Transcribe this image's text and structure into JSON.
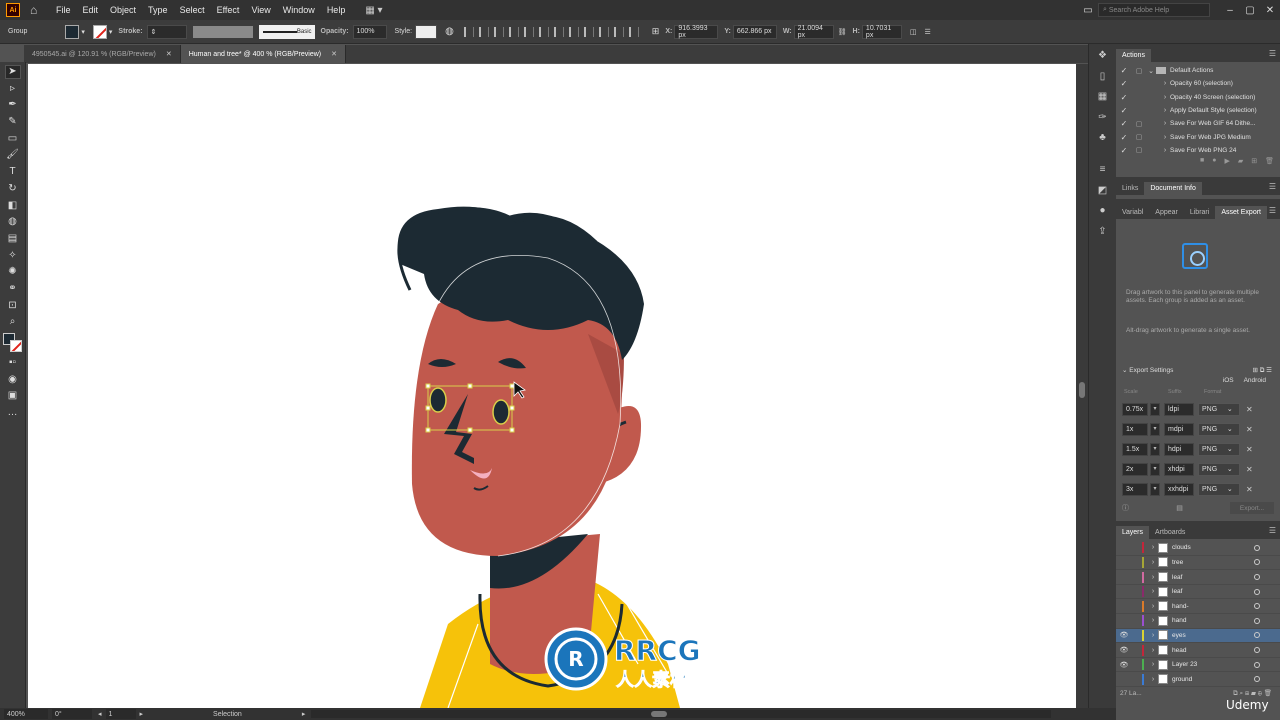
{
  "app": {
    "logo_text": "Ai"
  },
  "menu": [
    "File",
    "Edit",
    "Object",
    "Type",
    "Select",
    "Effect",
    "View",
    "Window",
    "Help"
  ],
  "search": {
    "placeholder": "Search Adobe Help"
  },
  "control_bar": {
    "selection_type": "Group",
    "stroke_label": "Stroke:",
    "brush": "Basic",
    "opacity_label": "Opacity:",
    "opacity_value": "100%",
    "style_label": "Style:",
    "x_label": "X:",
    "x_value": "916.3993 px",
    "y_label": "Y:",
    "y_value": "662.866 px",
    "w_label": "W:",
    "w_value": "21.0094 px",
    "h_label": "H:",
    "h_value": "10.7031 px"
  },
  "tabs": [
    {
      "label": "4950545.ai @ 120.91 % (RGB/Preview)",
      "active": false
    },
    {
      "label": "Human and tree* @ 400 % (RGB/Preview)",
      "active": true
    }
  ],
  "status_bar": {
    "zoom": "400%",
    "rotation": "0°",
    "artboard": "1",
    "tool": "Selection"
  },
  "actions_panel": {
    "tab": "Actions",
    "items": [
      {
        "label": "Default Actions",
        "folder": true
      },
      {
        "label": "Opacity 60 (selection)"
      },
      {
        "label": "Opacity 40 Screen (selection)"
      },
      {
        "label": "Apply Default Style (selection)"
      },
      {
        "label": "Save For Web GIF 64 Dithe..."
      },
      {
        "label": "Save For Web JPG Medium"
      },
      {
        "label": "Save For Web PNG 24"
      }
    ]
  },
  "links_tabs": [
    "Links",
    "Document Info"
  ],
  "asset_tabs": [
    "Variabl",
    "Appear",
    "Librari",
    "Asset Export"
  ],
  "asset_export": {
    "drag_text": "Drag artwork to this panel to generate multiple assets. Each group is added as an asset.",
    "alt_text": "Alt-drag artwork to generate a single asset.",
    "export_settings": "Export Settings",
    "ios": "iOS",
    "android": "Android",
    "col_scale": "Scale",
    "col_suffix": "Suffix",
    "col_format": "Format",
    "rows": [
      {
        "scale": "0.75x",
        "suffix": "ldpi",
        "format": "PNG"
      },
      {
        "scale": "1x",
        "suffix": "mdpi",
        "format": "PNG"
      },
      {
        "scale": "1.5x",
        "suffix": "hdpi",
        "format": "PNG"
      },
      {
        "scale": "2x",
        "suffix": "xhdpi",
        "format": "PNG"
      },
      {
        "scale": "3x",
        "suffix": "xxhdpi",
        "format": "PNG"
      }
    ],
    "export_button": "Export..."
  },
  "layers_tabs": [
    "Layers",
    "Artboards"
  ],
  "layers": [
    {
      "name": "clouds",
      "color": "#c3263a",
      "visible": false
    },
    {
      "name": "tree",
      "color": "#a6a636",
      "visible": false
    },
    {
      "name": "leaf",
      "color": "#d16aa0",
      "visible": false
    },
    {
      "name": "leaf",
      "color": "#8a2a6a",
      "visible": false
    },
    {
      "name": "hand-",
      "color": "#d97a2a",
      "visible": false
    },
    {
      "name": "hand",
      "color": "#9b4fd0",
      "visible": false
    },
    {
      "name": "eyes",
      "color": "#d9d233",
      "visible": true,
      "selected": true
    },
    {
      "name": "head",
      "color": "#c3263a",
      "visible": true
    },
    {
      "name": "Layer 23",
      "color": "#4caf50",
      "visible": true
    },
    {
      "name": "ground",
      "color": "#3a7bd5",
      "visible": false
    }
  ],
  "layers_footer": "27 La...",
  "watermark": {
    "big": "RRCG",
    "small": "人人素材"
  },
  "udemy": "Udemy",
  "colors": {
    "skin": "#c1594d",
    "hair": "#1c2a33",
    "shirt": "#f6c20a",
    "selection": "#d9cf4a"
  }
}
